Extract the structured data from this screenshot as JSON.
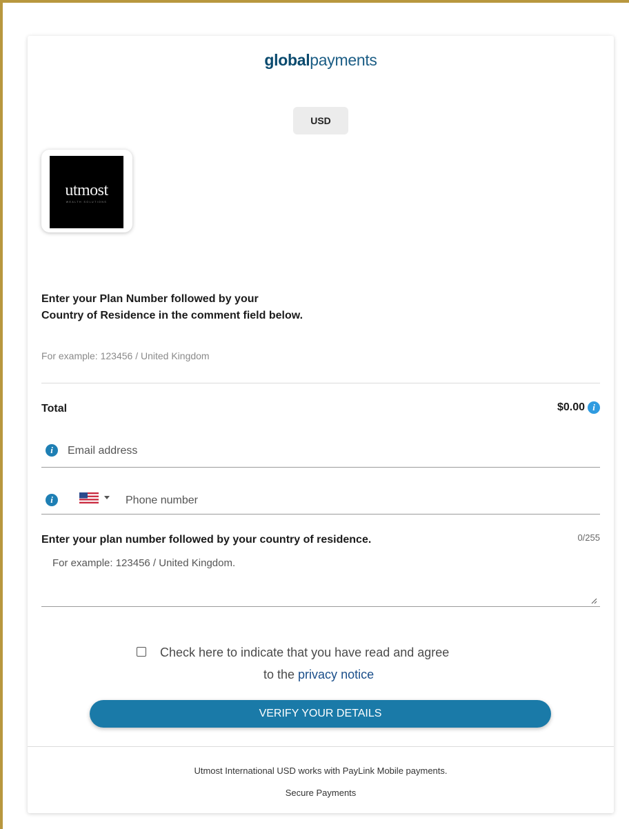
{
  "brand": {
    "bold": "global",
    "regular": "payments"
  },
  "currency": "USD",
  "merchant_logo": {
    "word": "utmost",
    "sub": "WEALTH SOLUTIONS"
  },
  "instructions": {
    "heading": "Enter your Plan Number followed by your Country of Residence in the comment field below.",
    "example": "For example: 123456 / United Kingdom"
  },
  "total": {
    "label": "Total",
    "amount": "$0.00"
  },
  "email": {
    "placeholder": "Email address",
    "value": ""
  },
  "phone": {
    "placeholder": "Phone number",
    "value": "",
    "country_icon": "us-flag-icon"
  },
  "comment": {
    "label": "Enter your plan number followed by your country of residence.",
    "count": "0/255",
    "placeholder": "For example: 123456 / United Kingdom."
  },
  "consent": {
    "line1": "Check here to indicate that you have read and agree",
    "line2_prefix": "to the ",
    "link_text": "privacy notice"
  },
  "verify_button": "VERIFY YOUR DETAILS",
  "footer": {
    "line1": "Utmost International USD works with PayLink Mobile payments.",
    "line2": "Secure Payments"
  },
  "colors": {
    "frame_border": "#b8973e",
    "primary_button": "#1a7aa8",
    "info_icon": "#1e7fb4",
    "link": "#1a4e8a"
  }
}
